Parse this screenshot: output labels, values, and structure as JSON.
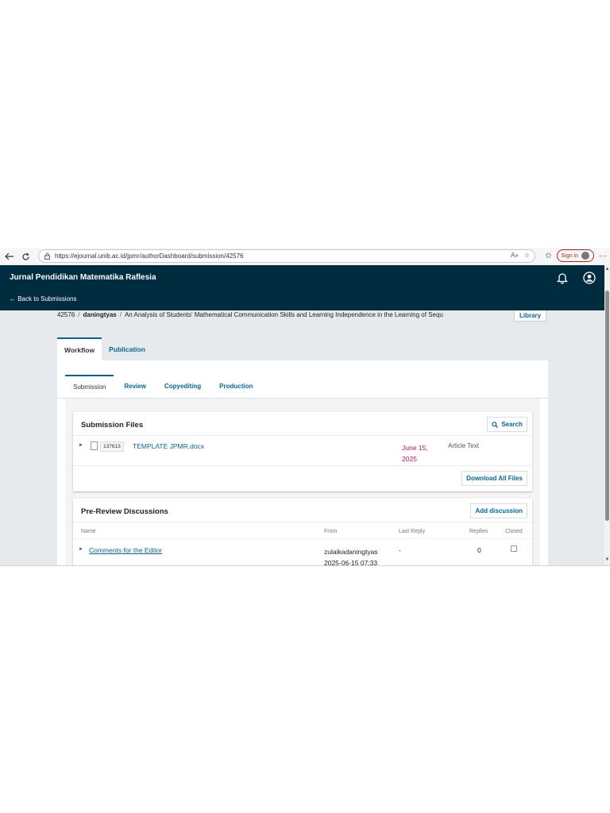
{
  "browser": {
    "url": "https://ejournal.unib.ac.id/jpmr/authorDashboard/submission/42576",
    "sign_in": "Sign in"
  },
  "header": {
    "site_title": "Jurnal Pendidikan Matematika Raflesia",
    "back_link": "← Back to Submissions"
  },
  "breadcrumb": {
    "id": "42576",
    "author": "daningtyas",
    "title": "An Analysis of Students' Mathematical Communication Skills and Learning Independence in the Learning of Sequ",
    "library": "Library"
  },
  "main_tabs": [
    {
      "label": "Workflow",
      "active": true
    },
    {
      "label": "Publication",
      "active": false
    }
  ],
  "sub_tabs": [
    {
      "label": "Submission",
      "active": true
    },
    {
      "label": "Review",
      "active": false
    },
    {
      "label": "Copyediting",
      "active": false
    },
    {
      "label": "Production",
      "active": false
    }
  ],
  "submission_files": {
    "title": "Submission Files",
    "search_label": "Search",
    "files": [
      {
        "id": "137613",
        "name": "TEMPLATE JPMR.docx",
        "date": "June 15, 2025",
        "type": "Article Text"
      }
    ],
    "download_all": "Download All Files"
  },
  "discussions": {
    "title": "Pre-Review Discussions",
    "add_label": "Add discussion",
    "columns": {
      "name": "Name",
      "from": "From",
      "last_reply": "Last Reply",
      "replies": "Replies",
      "closed": "Closed"
    },
    "rows": [
      {
        "name": "Comments for the Editor",
        "from_user": "zulaikadaningtyas",
        "from_date": "2025-06-15 07:33",
        "last_reply": "-",
        "replies": "0",
        "closed": false
      }
    ]
  },
  "colors": {
    "header_bg": "#002c40",
    "link": "#006798",
    "date": "#b3105b",
    "page_bg": "#e7eaed"
  }
}
